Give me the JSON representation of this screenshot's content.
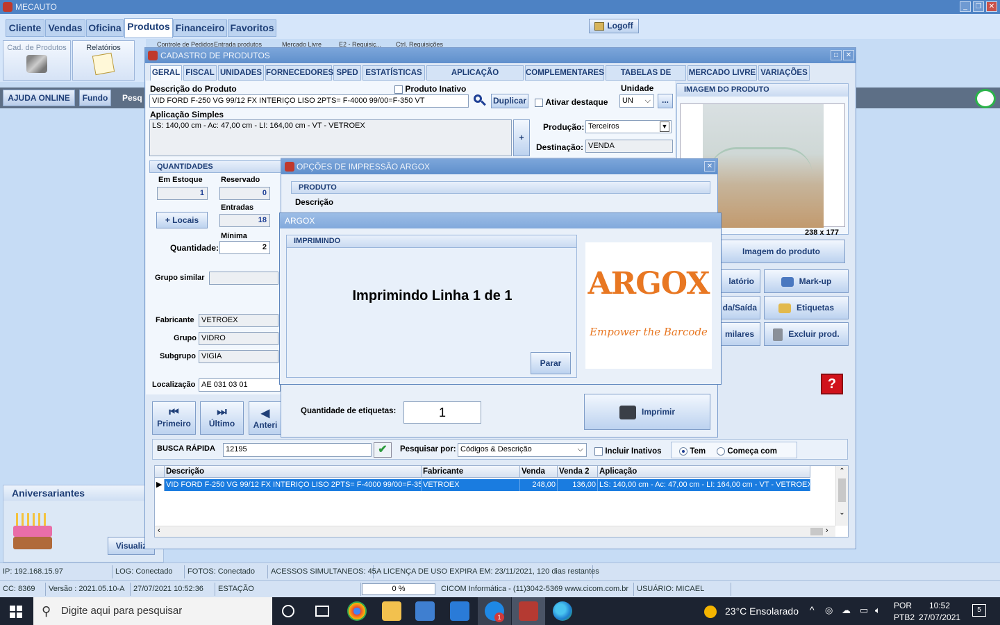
{
  "app": {
    "title": "MECAUTO"
  },
  "menu": {
    "tabs": [
      "Cliente",
      "Vendas",
      "Oficina",
      "Produtos",
      "Financeiro",
      "Favoritos"
    ],
    "logoff": "Logoff"
  },
  "ribbon": {
    "cad_produtos": "Cad. de Produtos",
    "relatorios": "Relatórios",
    "sub_tabs": [
      "Controle de Pedidos",
      "Entrada produtos",
      "Mercado Livre",
      "E2 - Requisiç...",
      "Ctrl. Requisições"
    ]
  },
  "toolbar2": {
    "ajuda": "AJUDA ONLINE",
    "fundo": "Fundo",
    "pesq": "Pesq"
  },
  "cadastro": {
    "title": "CADASTRO DE PRODUTOS",
    "tabs": [
      "GERAL",
      "FISCAL",
      "UNIDADES",
      "FORNECEDORES",
      "SPED",
      "ESTATÍSTICAS",
      "APLICAÇÃO ESPECÍFICA",
      "COMPLEMENTARES",
      "TABELAS DE PREÇO",
      "MERCADO LIVRE",
      "VARIAÇÕES"
    ],
    "descricao_label": "Descrição do Produto",
    "descricao_value": "VID FORD F-250 VG 99/12 FX INTERIÇO LISO 2PTS= F-4000 99/00=F-350 VT",
    "produto_inativo": "Produto Inativo",
    "duplicar": "Duplicar",
    "ativar_destaque": "Ativar destaque",
    "unidade_label": "Unidade",
    "unidade_value": "UN",
    "more_btn": "...",
    "aplicacao_label": "Aplicação Simples",
    "aplicacao_value": "LS: 140,00 cm - Ac: 47,00 cm - LI: 164,00 cm - VT - VETROEX",
    "plus_btn": "+",
    "producao_label": "Produção:",
    "producao_value": "Terceiros",
    "destinacao_label": "Destinação:",
    "destinacao_value": "VENDA",
    "quantidades_hdr": "QUANTIDADES",
    "em_estoque_label": "Em Estoque",
    "em_estoque_value": "1",
    "reservado_label": "Reservado",
    "reservado_value": "0",
    "entradas_label": "Entradas",
    "entradas_value": "18",
    "locais_btn": "+ Locais",
    "minima_label": "Mínima",
    "quantidade_label": "Quantidade:",
    "quantidade_value": "2",
    "grupo_similar_label": "Grupo similar",
    "fabricante_label": "Fabricante",
    "fabricante_value": "VETROEX",
    "grupo_label": "Grupo",
    "grupo_value": "VIDRO",
    "subgrupo_label": "Subgrupo",
    "subgrupo_value": "VIGIA",
    "localizacao_label": "Localização",
    "localizacao_value": "AE 031 03 01",
    "nav": {
      "primeiro": "Primeiro",
      "ultimo": "Último",
      "anterior": "Anteri"
    },
    "imagem_hdr": "IMAGEM DO PRODUTO",
    "imagem_size": "238 x 177",
    "imagem_btn": "Imagem do produto",
    "side_btns": {
      "relatorio": "latório",
      "markup": "Mark-up",
      "entrada_saida": "da/Saída",
      "etiquetas": "Etiquetas",
      "similares": "milares",
      "excluir": "Excluir prod."
    },
    "help_icon_text": "?",
    "busca_label": "BUSCA RÁPIDA",
    "busca_value": "12195",
    "pesquisar_por_label": "Pesquisar por:",
    "pesquisar_por_value": "Códigos & Descrição",
    "incluir_inativos": "Incluir Inativos",
    "radio_tem": "Tem",
    "radio_comeca": "Começa com",
    "grid": {
      "headers": [
        "Descrição",
        "Fabricante",
        "Venda",
        "Venda 2",
        "Aplicação"
      ],
      "rows": [
        [
          "VID FORD F-250 VG 99/12 FX INTERIÇO LISO 2PTS= F-4000 99/00=F-350 VT",
          "VETROEX",
          "248,00",
          "136,00",
          "LS: 140,00 cm - Ac: 47,00 cm - LI: 164,00 cm - VT - VETROEX"
        ]
      ]
    }
  },
  "argox_opts": {
    "title": "OPÇÕES DE IMPRESSÃO ARGOX",
    "produto_hdr": "PRODUTO",
    "descricao_label": "Descrição",
    "qtd_label": "Quantidade de etiquetas:",
    "qtd_value": "1",
    "imprimir": "Imprimir"
  },
  "argox_dialog": {
    "title": "ARGOX",
    "imprimindo_hdr": "IMPRIMINDO",
    "message": "Imprimindo Linha 1 de 1",
    "parar": "Parar",
    "logo_text": "ARGOX",
    "logo_tagline": "Empower the Barcode"
  },
  "aniversariantes": {
    "title": "Aniversariantes",
    "visualizar": "Visualiz"
  },
  "status1": [
    "IP: 192.168.15.97",
    "LOG: Conectado",
    "FOTOS: Conectado",
    "ACESSOS SIMULTANEOS: 45",
    "A LICENÇA DE USO EXPIRA EM: 23/11/2021, 120 dias restantes"
  ],
  "status2": {
    "cc": "CC: 8369",
    "versao": "Versão : 2021.05.10-A",
    "datetime": "27/07/2021 10:52:36",
    "estacao": "ESTAÇÃO",
    "progress": "0 %",
    "cicom": "CICOM Informática - (11)3042-5369 www.cicom.com.br",
    "usuario": "USUÁRIO: MICAEL"
  },
  "taskbar": {
    "search_placeholder": "Digite aqui para pesquisar",
    "weather": "23°C  Ensolarado",
    "lang1": "POR",
    "lang2": "PTB2",
    "time": "10:52",
    "date": "27/07/2021",
    "notif": "5",
    "badge": "1"
  },
  "colors": {
    "accent": "#1a7ce0",
    "title_blue": "#4d82c4",
    "argox_orange": "#e87722"
  }
}
